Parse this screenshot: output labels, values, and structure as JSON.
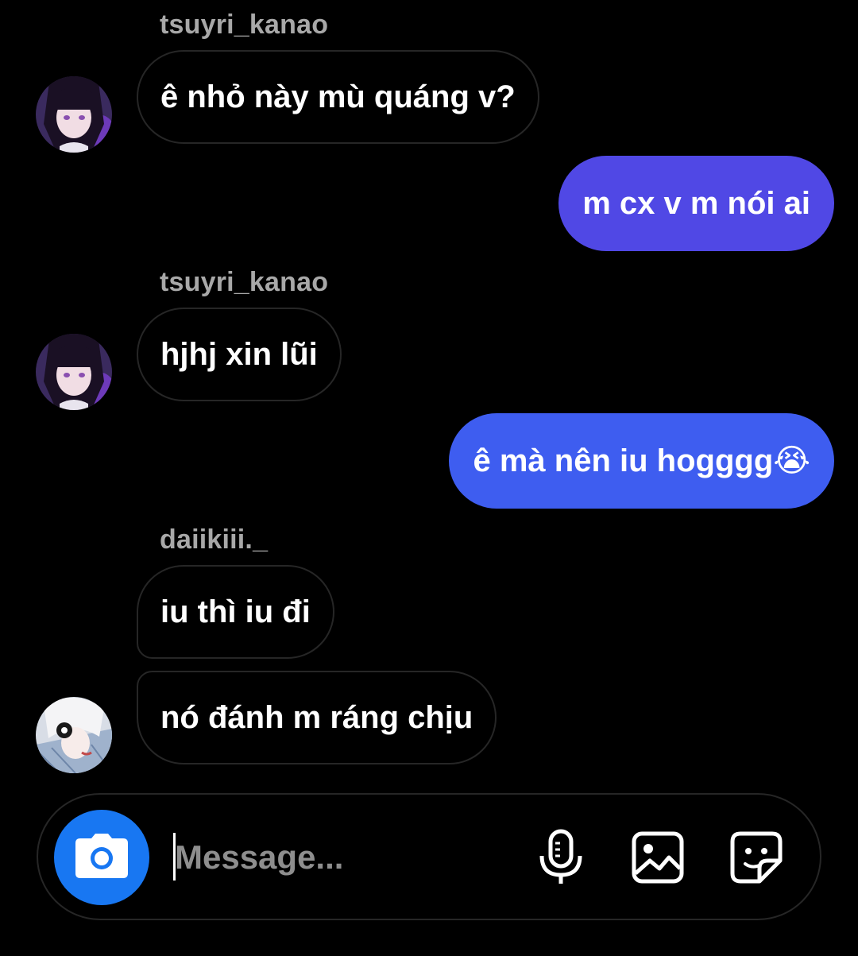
{
  "messages": [
    {
      "sender": "tsuyri_kanao",
      "text": "ê nhỏ này mù quáng v?"
    },
    {
      "text": "m cx v m nói ai"
    },
    {
      "sender": "tsuyri_kanao",
      "text": "hjhj xin lũi"
    },
    {
      "text": "ê mà nên iu hogggg😭"
    },
    {
      "sender": "daiikiii._",
      "text": "iu thì iu đi"
    },
    {
      "text": "nó đánh m ráng chịu"
    }
  ],
  "composer": {
    "placeholder": "Message...",
    "icons": [
      "camera-icon",
      "microphone-icon",
      "gallery-icon",
      "sticker-icon"
    ]
  },
  "colors": {
    "background": "#000000",
    "outgoing_gradient": [
      "#5a3fe8",
      "#3b5ff0"
    ],
    "camera_button": "#1877f2",
    "incoming_border": "#262626",
    "sender_name": "#a8a8a8"
  }
}
